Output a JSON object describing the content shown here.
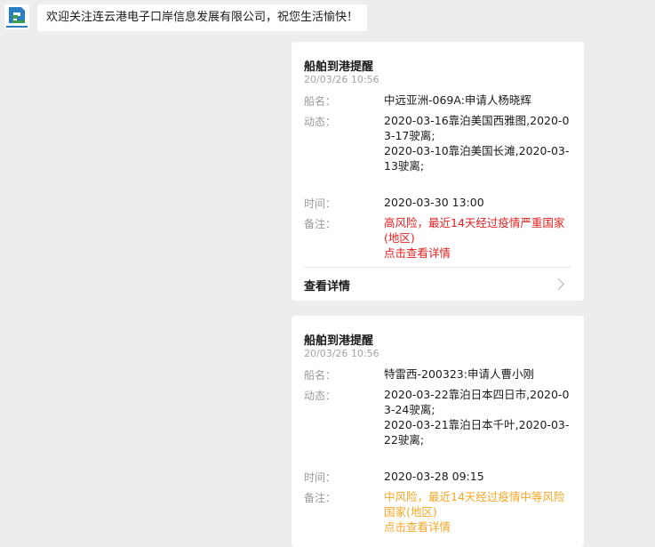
{
  "welcome": {
    "avatar_icon": "company-logo",
    "text": "欢迎关注连云港电子口岸信息发展有限公司，祝您生活愉快！"
  },
  "cards": [
    {
      "title": "船舶到港提醒",
      "datetime": "20/03/26 10:56",
      "ship_label": "船名：",
      "ship_value": "中远亚洲-069A:申请人杨晓辉",
      "dynamics_label": "动态：",
      "dynamics_lines": [
        "2020-03-16靠泊美国西雅图,2020-03-17驶离;",
        "2020-03-10靠泊美国长滩,2020-03-13驶离;"
      ],
      "time_label": "时间：",
      "time_value": "2020-03-30 13:00",
      "remark_label": "备注：",
      "remark_value": "高风险，最近14天经过疫情严重国家(地区)",
      "remark_link": "点击查看详情",
      "risk_color": "#e02020",
      "view_details": "查看详情"
    },
    {
      "title": "船舶到港提醒",
      "datetime": "20/03/26 10:56",
      "ship_label": "船名：",
      "ship_value": "特雷西-200323:申请人曹小刚",
      "dynamics_label": "动态：",
      "dynamics_lines": [
        "2020-03-22靠泊日本四日市,2020-03-24驶离;",
        "2020-03-21靠泊日本千叶,2020-03-22驶离;"
      ],
      "time_label": "时间：",
      "time_value": "2020-03-28 09:15",
      "remark_label": "备注：",
      "remark_value": "中风险，最近14天经过疫情中等风险国家(地区)",
      "remark_link": "点击查看详情",
      "risk_color": "#f5a623"
    }
  ]
}
